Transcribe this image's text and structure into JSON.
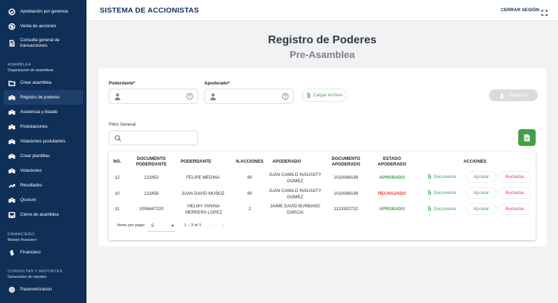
{
  "sidebar": {
    "top_items": [
      {
        "label": "Aprobación por gerencia",
        "icon": "check-circle-icon"
      },
      {
        "label": "Venta de acciones",
        "icon": "dollar-circle-icon"
      },
      {
        "label": "Consulta general de transacciones",
        "icon": "document-icon"
      }
    ],
    "asamblea": {
      "title": "ASAMBLEA",
      "subtitle": "Organizacion de asambleas",
      "items": [
        {
          "label": "Crear asamblea",
          "icon": "folder-icon"
        },
        {
          "label": "Registro de poderes",
          "icon": "group-icon"
        },
        {
          "label": "Asistencia y listado",
          "icon": "group-icon"
        },
        {
          "label": "Postulaciones",
          "icon": "group-icon"
        },
        {
          "label": "Votaciones postulantes",
          "icon": "group-icon"
        },
        {
          "label": "Crear plantillas",
          "icon": "group-icon"
        },
        {
          "label": "Votaciones",
          "icon": "group-icon"
        },
        {
          "label": "Resultados",
          "icon": "trend-icon"
        },
        {
          "label": "Quorum",
          "icon": "group-icon"
        },
        {
          "label": "Cierre de asamblea",
          "icon": "inbox-icon"
        }
      ],
      "active_index": 1
    },
    "financiero": {
      "title": "FINANCIERO",
      "subtitle": "Manejo financiero",
      "items": [
        {
          "label": "Financiero",
          "icon": "dollar-icon"
        }
      ]
    },
    "consultas": {
      "title": "CONSULTAS Y REPORTES",
      "subtitle": "Generación de reportes",
      "items": [
        {
          "label": "Parametrizacion",
          "icon": "settings-icon"
        }
      ]
    }
  },
  "header": {
    "title": "SISTEMA DE ACCIONISTAS",
    "logout": "CERRAR SESIÓN"
  },
  "page": {
    "title": "Registro de Poderes",
    "subtitle": "Pre-Asamblea"
  },
  "form": {
    "poderdante_label": "Poderdante*",
    "poderdante_value": "",
    "apoderado_label": "Apoderado*",
    "apoderado_value": "",
    "upload_label": "Cargar Archivo",
    "register_label": "Registrar",
    "filter_label": "Filtro General",
    "filter_value": ""
  },
  "table": {
    "headers": {
      "no": "NO.",
      "doc_poderdante": "DOCUMENTO PODERDANTE",
      "poderdante": "PODERDANTE",
      "acciones": "N.ACCIONES",
      "apoderado": "APODERADO",
      "doc_apoderado": "DOCUMENTO APODERADO",
      "estado": "ESTADO APODERADO",
      "actions": "ACCIONES"
    },
    "rows": [
      {
        "no": "12",
        "doc_poderdante": "123452",
        "poderdante": "FELIPE MEDINA",
        "acciones": "90",
        "apoderado": "JUAN CAMILO INSUASTY GOMEZ",
        "doc_apoderado": "1010086199",
        "estado": "APROBADO",
        "doc_link": "Documento",
        "approve": "Aprobar",
        "reject": "Rechazar"
      },
      {
        "no": "10",
        "doc_poderdante": "123456",
        "poderdante": "JUAN DAVID MUÑOZ",
        "acciones": "90",
        "apoderado": "JUAN CAMILO INSUASTY GOMEZ",
        "doc_apoderado": "1010086199",
        "estado": "RECHAZADO",
        "doc_link": "Documento",
        "approve": "Aprobar",
        "reject": "Rechazar"
      },
      {
        "no": "11",
        "doc_poderdante": "1006847220",
        "poderdante": "HELMY YANINA HERRERA LOPEZ",
        "acciones": "2",
        "apoderado": "JAIME DAVID BURBANO GARCIA",
        "doc_apoderado": "1123302722",
        "estado": "APROBADO",
        "doc_link": "Documento",
        "approve": "Aprobar",
        "reject": "Rechazar"
      }
    ],
    "pagination": {
      "items_label": "Items per page:",
      "items_value": "5",
      "range": "1 – 3 of 3"
    }
  },
  "colors": {
    "sidebar_bg": "#0f2f57",
    "approved": "#43a047",
    "rejected": "#e53935"
  }
}
